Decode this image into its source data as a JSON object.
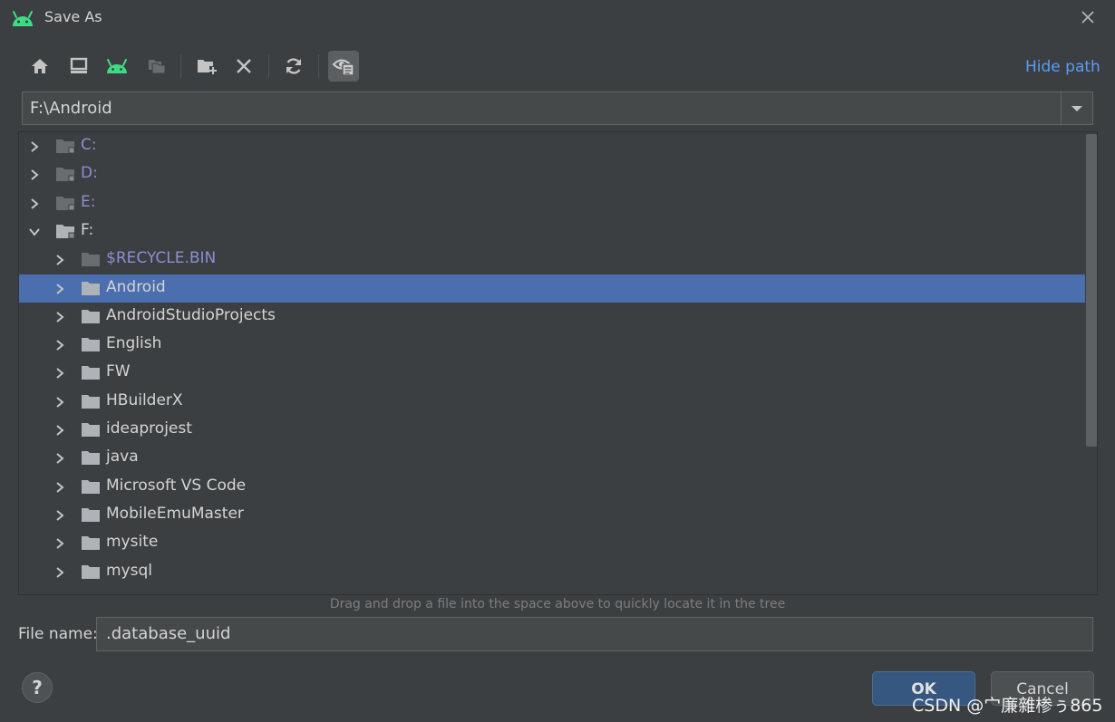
{
  "window": {
    "title": "Save As",
    "app_icon": "android-icon",
    "close_icon": "close-icon"
  },
  "toolbar": {
    "buttons": [
      {
        "name": "home",
        "icon": "home-icon"
      },
      {
        "name": "desktop",
        "icon": "desktop-icon"
      },
      {
        "name": "project",
        "icon": "android-icon"
      },
      {
        "name": "module",
        "icon": "folders-icon"
      },
      {
        "name": "new-folder",
        "icon": "new-folder-icon"
      },
      {
        "name": "delete",
        "icon": "delete-icon"
      },
      {
        "name": "refresh",
        "icon": "refresh-icon"
      },
      {
        "name": "show-hidden",
        "icon": "show-hidden-icon"
      }
    ],
    "hide_path_label": "Hide path"
  },
  "path": {
    "value": "F:\\Android"
  },
  "tree": {
    "items": [
      {
        "label": "C:",
        "expanded": false,
        "drive": true
      },
      {
        "label": "D:",
        "expanded": false,
        "drive": true
      },
      {
        "label": "E:",
        "expanded": false,
        "drive": true
      },
      {
        "label": "F:",
        "expanded": true,
        "drive": true
      },
      {
        "label": "$RECYCLE.BIN",
        "expanded": false,
        "hidden": true
      },
      {
        "label": "Android",
        "expanded": false,
        "selected": true
      },
      {
        "label": "AndroidStudioProjects",
        "expanded": false
      },
      {
        "label": "English",
        "expanded": false
      },
      {
        "label": "FW",
        "expanded": false
      },
      {
        "label": "HBuilderX",
        "expanded": false
      },
      {
        "label": "ideaprojest",
        "expanded": false
      },
      {
        "label": "java",
        "expanded": false
      },
      {
        "label": "Microsoft VS Code",
        "expanded": false
      },
      {
        "label": "MobileEmuMaster",
        "expanded": false
      },
      {
        "label": "mysite",
        "expanded": false
      },
      {
        "label": "mysql",
        "expanded": false
      }
    ]
  },
  "hint": "Drag and drop a file into the space above to quickly locate it in the tree",
  "file_name": {
    "label": "File name:",
    "value": ".database_uuid"
  },
  "footer": {
    "help_label": "?",
    "ok_label": "OK",
    "cancel_label": "Cancel"
  },
  "watermark": "CSDN @宀廉雜椮ぅ865",
  "colors": {
    "background": "#3c3f41",
    "selection": "#4b6eaf",
    "link": "#589df6",
    "ok_button": "#365880",
    "android_green": "#3ddc84"
  }
}
